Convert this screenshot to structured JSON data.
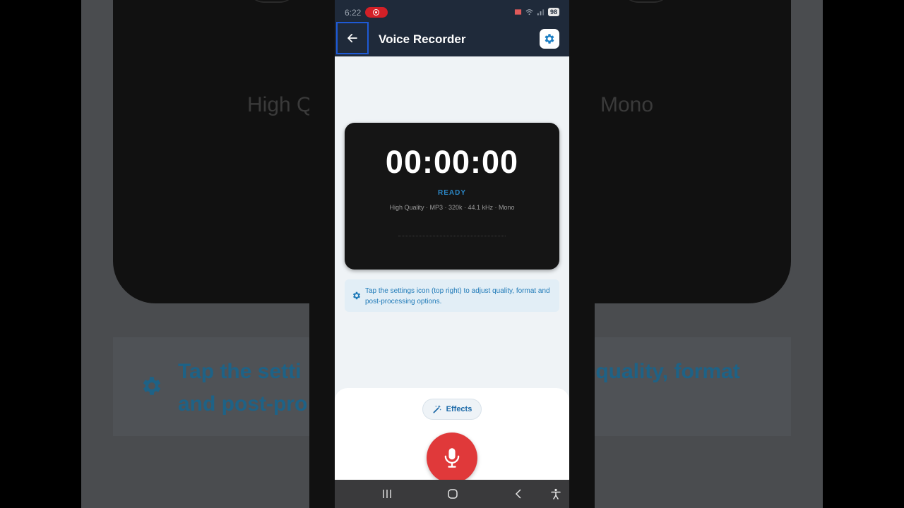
{
  "status_bar": {
    "time": "6:22",
    "battery": "98"
  },
  "app_bar": {
    "title": "Voice Recorder"
  },
  "recorder": {
    "timer": "00:00:00",
    "state": "READY",
    "quality_line": "High Quality · MP3 · 320k · 44.1 kHz · Mono"
  },
  "tip": {
    "text": "Tap the settings icon (top right) to adjust quality, format and post-processing options."
  },
  "controls": {
    "effects_label": "Effects"
  },
  "background": {
    "left_text": "High Q",
    "right_text": "Mono",
    "tip_left": "Tap the setti",
    "tip_left_2": "and post-pro",
    "tip_right": "t quality, format"
  },
  "colors": {
    "app_bar": "#1f2a3a",
    "accent_blue": "#2b86c5",
    "record_red": "#e0393a",
    "focus_outline": "#1e5ad6"
  },
  "icons": {
    "back": "arrow-left-icon",
    "settings": "gear-icon",
    "effects": "magic-wand-icon",
    "record": "microphone-icon"
  }
}
